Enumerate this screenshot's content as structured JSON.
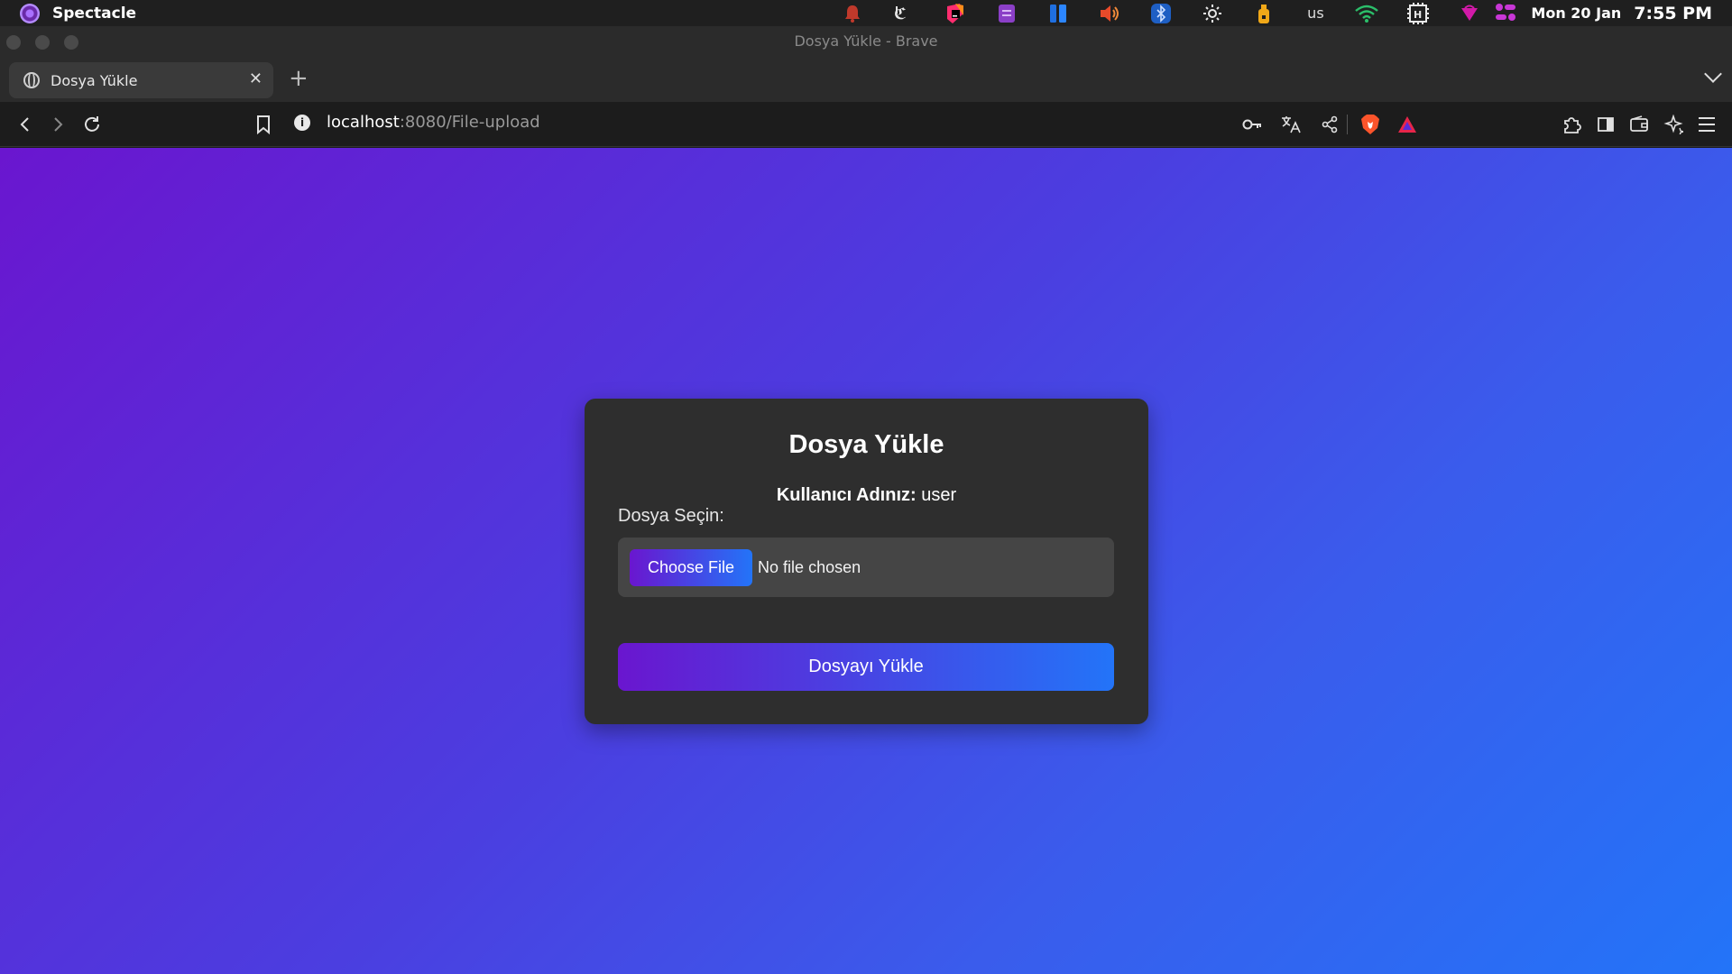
{
  "system_bar": {
    "app_name": "Spectacle",
    "keyboard_layout": "us",
    "date": "Mon 20 Jan",
    "time": "7:55 PM",
    "tray_icons": [
      "notification-bell-icon",
      "kde-connect-icon",
      "jetbrains-toolbox-icon",
      "clipboard-icon",
      "activity-panel-icon",
      "volume-icon",
      "bluetooth-icon",
      "brightness-icon",
      "usb-drive-icon",
      "keyboard-layout-icon",
      "wifi-icon",
      "cpu-monitor-icon",
      "vpn-icon",
      "app-menu-icon"
    ]
  },
  "window": {
    "title": "Dosya Yükle - Brave"
  },
  "tabs": [
    {
      "title": "Dosya Yükle",
      "favicon": "globe-icon",
      "active": true
    }
  ],
  "toolbar": {
    "url_host": "localhost",
    "url_rest": ":8080/File-upload"
  },
  "upload_card": {
    "title": "Dosya Yükle",
    "username_label": "Kullanıcı Adınız:",
    "username_value": "user",
    "file_label": "Dosya Seçin:",
    "choose_file_label": "Choose File",
    "no_file_text": "No file chosen",
    "submit_label": "Dosyayı Yükle"
  },
  "colors": {
    "gradient_start": "#6a16cf",
    "gradient_end": "#2374f8",
    "card_bg": "#2e2e2e",
    "file_box_bg": "#454545"
  }
}
